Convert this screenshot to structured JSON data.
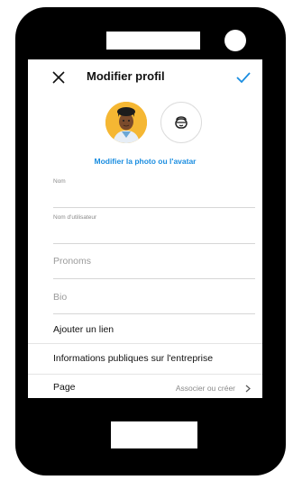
{
  "header": {
    "title": "Modifier profil",
    "close_icon": "close-icon",
    "confirm_icon": "check-icon",
    "accent": "#1a8de0"
  },
  "profile": {
    "change_photo_label": "Modifier la photo ou l'avatar",
    "avatar_bg": "#f5b733",
    "avatar_alt_icon": "avatar-face-icon"
  },
  "fields": {
    "name_label": "Nom",
    "name_value": "",
    "username_label": "Nom d'utilisateur",
    "username_value": "",
    "pronouns_placeholder": "Pronoms",
    "bio_placeholder": "Bio"
  },
  "rows": {
    "add_link": "Ajouter un lien",
    "business_info": "Informations publiques sur l'entreprise",
    "page_label": "Page",
    "page_action": "Associer ou créer"
  }
}
